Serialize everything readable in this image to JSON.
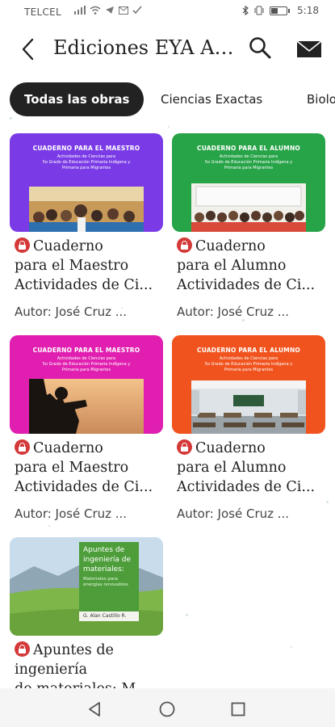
{
  "status_bar": {
    "carrier": "TELCEL",
    "time": "5:18"
  },
  "header": {
    "title": "Ediciones EYA AC...",
    "search_icon": "search-icon",
    "mail_icon": "mail-icon",
    "back_icon": "arrow-back-icon"
  },
  "tabs": [
    {
      "label": "Todas las obras",
      "active": true
    },
    {
      "label": "Ciencias Exactas",
      "active": false
    },
    {
      "label": "Biolo",
      "active": false
    }
  ],
  "books": [
    {
      "title": "Cuaderno para el Maestro Actividades de Ci...",
      "title_lines": [
        "Cuaderno",
        "para el Maestro",
        "Actividades de Ci..."
      ],
      "author": "Autor: José Cruz ...",
      "cover_heading": "CUADERNO PARA EL MAESTRO",
      "cover_sub": [
        "Actividades de Ciencias para",
        "5o Grado de Educación Primaria Indígena y",
        "Primaria para Migrantes"
      ],
      "cover_color": "#7a3be6"
    },
    {
      "title": "Cuaderno para el Alumno Actividades de Ci...",
      "title_lines": [
        "Cuaderno",
        "para el Alumno",
        "Actividades de Ci..."
      ],
      "author": "Autor: José Cruz ...",
      "cover_heading": "CUADERNO PARA EL ALUMNO",
      "cover_sub": [
        "Actividades de Ciencias para",
        "5o Grado de Educación Primaria Indígena y",
        "Primaria para Migrantes"
      ],
      "cover_color": "#27a348"
    },
    {
      "title": "Cuaderno para el Maestro Actividades de Ci...",
      "title_lines": [
        "Cuaderno",
        "para el Maestro",
        "Actividades de Ci..."
      ],
      "author": "Autor: José Cruz ...",
      "cover_heading": "CUADERNO PARA EL MAESTRO",
      "cover_sub": [
        "Actividades de Ciencias para",
        "5o Grado de Educación Primaria Indígena y",
        "Primaria para Migrantes"
      ],
      "cover_color": "#e01fb0"
    },
    {
      "title": "Cuaderno para el Alumno Actividades de Ci...",
      "title_lines": [
        "Cuaderno",
        "para el Alumno",
        "Actividades de Ci..."
      ],
      "author": "Autor: José Cruz ...",
      "cover_heading": "CUADERNO PARA EL ALUMNO",
      "cover_sub": [
        "Actividades de Ciencias para",
        "5o Grado de Educación Primaria Indígena y",
        "Primaria para Migrantes"
      ],
      "cover_color": "#f0531d"
    },
    {
      "title": "Apuntes de ingeniería de materiales: M",
      "title_lines": [
        "Apuntes de",
        "ingeniería",
        "de materiales: M"
      ],
      "author": "",
      "cover_heading": "Apuntes de ingeniería de materiales:",
      "cover_sub": [
        "Materiales para",
        "energías renovables"
      ],
      "cover_author": "G. Alan Castillo R.",
      "cover_color": "#4d9e3a"
    }
  ],
  "navbar": {
    "back_icon": "nav-back-icon",
    "home_icon": "nav-home-icon",
    "recents_icon": "nav-recents-icon"
  }
}
